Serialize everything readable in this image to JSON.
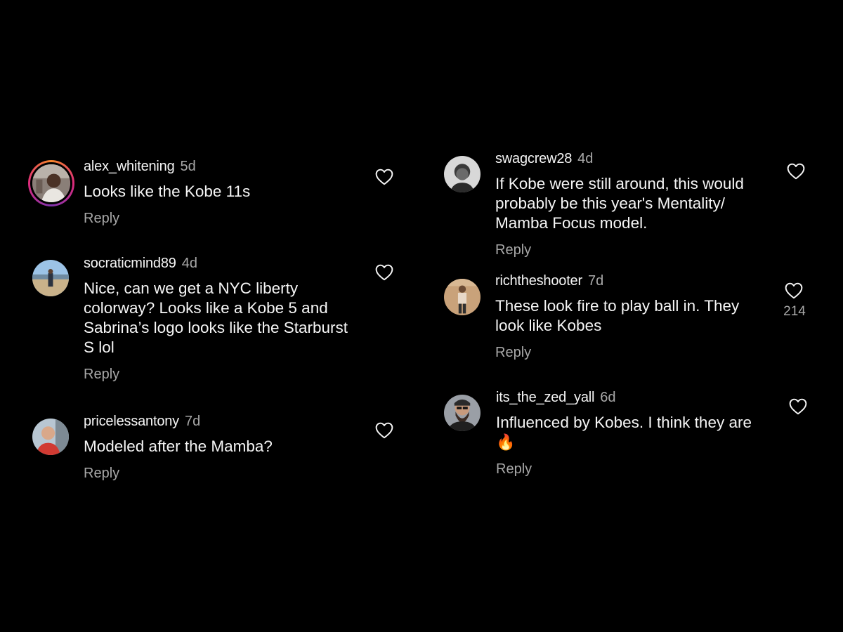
{
  "reply_label": "Reply",
  "colors": {
    "background": "#000000",
    "primary_text": "#f5f5f5",
    "secondary_text": "#a8a8a8"
  },
  "comments": [
    {
      "username": "alex_whitening",
      "time": "5d",
      "lines": [
        "Looks like the Kobe 11s"
      ],
      "avatar_icon": "user-avatar-story-ring"
    },
    {
      "username": "socraticmind89",
      "time": "4d",
      "lines": [
        "Nice, can we get a NYC liberty",
        "colorway? Looks like a Kobe 5 and",
        "Sabrina’s logo looks like the Starburst",
        "S lol"
      ],
      "avatar_icon": "user-avatar"
    },
    {
      "username": "pricelessantony",
      "time": "7d",
      "lines": [
        "Modeled after the Mamba?"
      ],
      "avatar_icon": "user-avatar"
    },
    {
      "username": "swagcrew28",
      "time": "4d",
      "lines": [
        "If Kobe were still around, this would",
        "probably be this year's Mentality/",
        "Mamba Focus model."
      ],
      "avatar_icon": "user-avatar"
    },
    {
      "username": "richtheshooter",
      "time": "7d",
      "lines": [
        "These look fire to play ball in. They",
        "look like Kobes"
      ],
      "like_count": "214",
      "avatar_icon": "user-avatar"
    },
    {
      "username": "its_the_zed_yall",
      "time": "6d",
      "lines": [
        "Influenced by Kobes. I think they are"
      ],
      "emoji": "🔥",
      "avatar_icon": "user-avatar"
    }
  ]
}
